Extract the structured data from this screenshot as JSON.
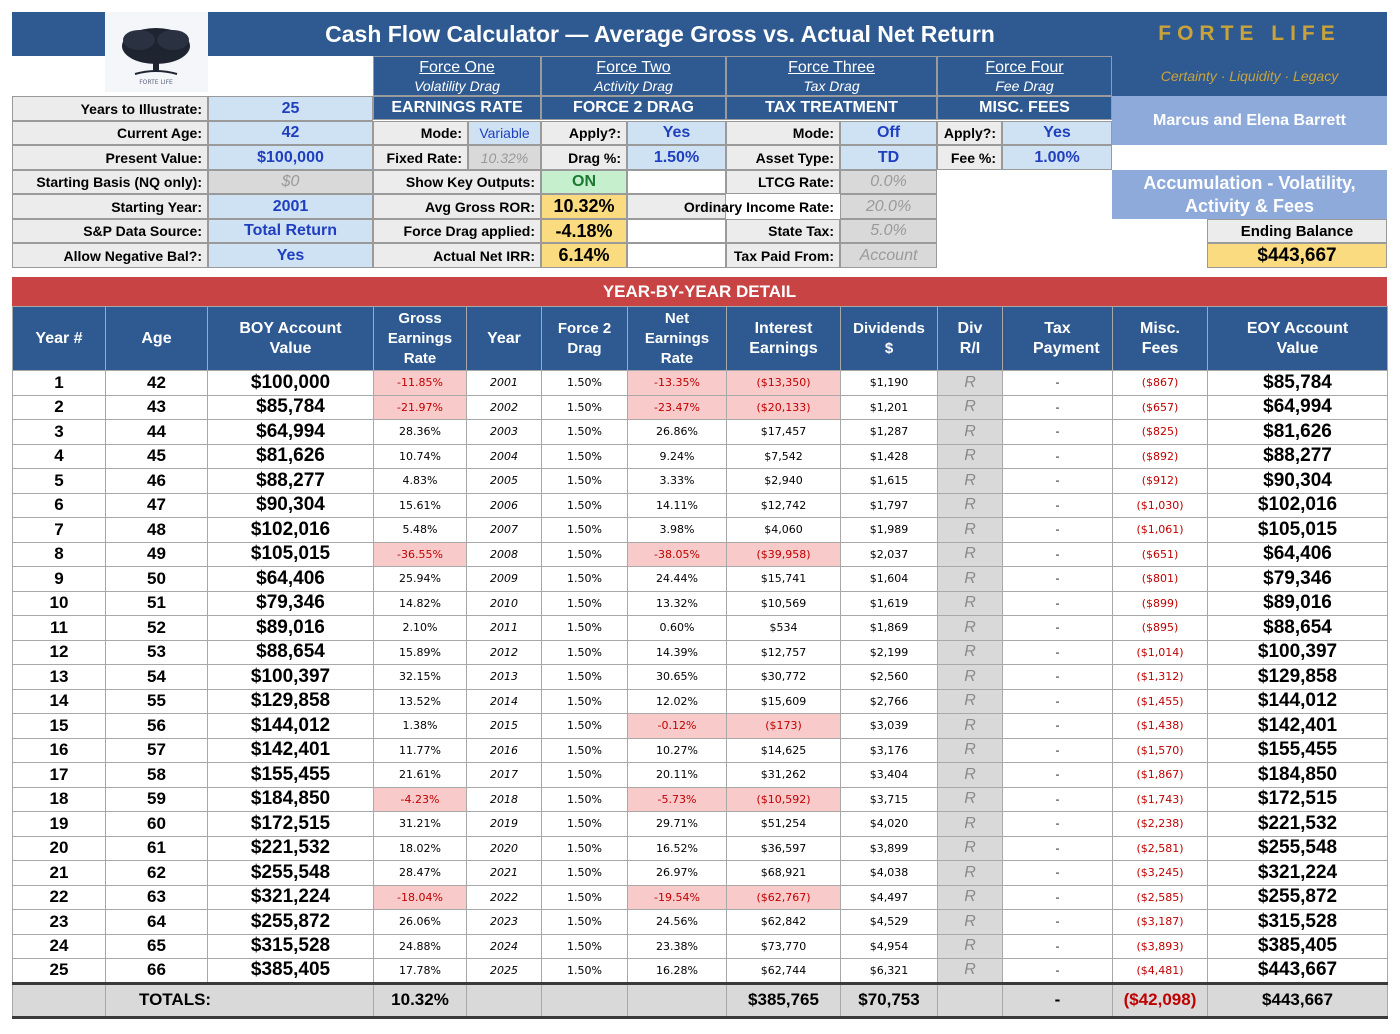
{
  "title": "Cash Flow Calculator — Average Gross vs. Actual Net Return",
  "logo_text": "FORTE LIFE",
  "brand": {
    "name": "FORTE LIFE",
    "tagline": "Certainty · Liquidity · Legacy"
  },
  "forces": [
    {
      "title": "Force One",
      "subtitle": "Volatility Drag",
      "section": "EARNINGS RATE"
    },
    {
      "title": "Force Two",
      "subtitle": "Activity Drag",
      "section": "FORCE 2 DRAG"
    },
    {
      "title": "Force Three",
      "subtitle": "Tax Drag",
      "section": "TAX TREATMENT"
    },
    {
      "title": "Force Four",
      "subtitle": "Fee Drag",
      "section": "MISC. FEES"
    }
  ],
  "inputs": {
    "years_label": "Years to Illustrate:",
    "years": "25",
    "age_label": "Current Age:",
    "age": "42",
    "pv_label": "Present Value:",
    "pv": "$100,000",
    "basis_label": "Starting Basis (NQ only):",
    "basis": "$0",
    "start_year_label": "Starting Year:",
    "start_year": "2001",
    "source_label": "S&P Data Source:",
    "source": "Total Return",
    "neg_label": "Allow Negative Bal?:",
    "neg": "Yes"
  },
  "force1": {
    "mode_label": "Mode:",
    "mode": "Variable",
    "fixed_label": "Fixed Rate:",
    "fixed": "10.32%",
    "show_label": "Show Key Outputs:",
    "show": "ON",
    "avg_label": "Avg Gross ROR:",
    "avg": "10.32%",
    "drag_label": "Force Drag applied:",
    "drag": "-4.18%",
    "irr_label": "Actual Net IRR:",
    "irr": "6.14%"
  },
  "force2": {
    "apply_label": "Apply?:",
    "apply": "Yes",
    "drag_label": "Drag %:",
    "drag": "1.50%"
  },
  "force3": {
    "mode_label": "Mode:",
    "mode": "Off",
    "asset_label": "Asset Type:",
    "asset": "TD",
    "ltcg_label": "LTCG Rate:",
    "ltcg": "0.0%",
    "ord_label": "Ordinary Income Rate:",
    "ord": "20.0%",
    "state_label": "State Tax:",
    "state": "5.0%",
    "paid_label": "Tax Paid From:",
    "paid": "Account"
  },
  "force4": {
    "apply_label": "Apply?:",
    "apply": "Yes",
    "fee_label": "Fee %:",
    "fee": "1.00%"
  },
  "client": "Marcus and Elena Barrett",
  "scenario": "Accumulation - Volatility, Activity & Fees",
  "ending_label": "Ending Balance",
  "ending_value": "$443,667",
  "detail_title": "YEAR-BY-YEAR DETAIL",
  "columns": [
    "Year #",
    "Age",
    "BOY Account Value",
    "Gross Earnings Rate",
    "Year",
    "Force 2 Drag",
    "Net Earnings Rate",
    "Interest Earnings",
    "Dividends $",
    "Div R/I",
    "Tax Payment",
    "Misc. Fees",
    "EOY Account Value"
  ],
  "rows": [
    [
      "1",
      "42",
      "$100,000",
      "-11.85%",
      "2001",
      "1.50%",
      "-13.35%",
      "($13,350)",
      "$1,190",
      "R",
      "-",
      "($867)",
      "$85,784"
    ],
    [
      "2",
      "43",
      "$85,784",
      "-21.97%",
      "2002",
      "1.50%",
      "-23.47%",
      "($20,133)",
      "$1,201",
      "R",
      "-",
      "($657)",
      "$64,994"
    ],
    [
      "3",
      "44",
      "$64,994",
      "28.36%",
      "2003",
      "1.50%",
      "26.86%",
      "$17,457",
      "$1,287",
      "R",
      "-",
      "($825)",
      "$81,626"
    ],
    [
      "4",
      "45",
      "$81,626",
      "10.74%",
      "2004",
      "1.50%",
      "9.24%",
      "$7,542",
      "$1,428",
      "R",
      "-",
      "($892)",
      "$88,277"
    ],
    [
      "5",
      "46",
      "$88,277",
      "4.83%",
      "2005",
      "1.50%",
      "3.33%",
      "$2,940",
      "$1,615",
      "R",
      "-",
      "($912)",
      "$90,304"
    ],
    [
      "6",
      "47",
      "$90,304",
      "15.61%",
      "2006",
      "1.50%",
      "14.11%",
      "$12,742",
      "$1,797",
      "R",
      "-",
      "($1,030)",
      "$102,016"
    ],
    [
      "7",
      "48",
      "$102,016",
      "5.48%",
      "2007",
      "1.50%",
      "3.98%",
      "$4,060",
      "$1,989",
      "R",
      "-",
      "($1,061)",
      "$105,015"
    ],
    [
      "8",
      "49",
      "$105,015",
      "-36.55%",
      "2008",
      "1.50%",
      "-38.05%",
      "($39,958)",
      "$2,037",
      "R",
      "-",
      "($651)",
      "$64,406"
    ],
    [
      "9",
      "50",
      "$64,406",
      "25.94%",
      "2009",
      "1.50%",
      "24.44%",
      "$15,741",
      "$1,604",
      "R",
      "-",
      "($801)",
      "$79,346"
    ],
    [
      "10",
      "51",
      "$79,346",
      "14.82%",
      "2010",
      "1.50%",
      "13.32%",
      "$10,569",
      "$1,619",
      "R",
      "-",
      "($899)",
      "$89,016"
    ],
    [
      "11",
      "52",
      "$89,016",
      "2.10%",
      "2011",
      "1.50%",
      "0.60%",
      "$534",
      "$1,869",
      "R",
      "-",
      "($895)",
      "$88,654"
    ],
    [
      "12",
      "53",
      "$88,654",
      "15.89%",
      "2012",
      "1.50%",
      "14.39%",
      "$12,757",
      "$2,199",
      "R",
      "-",
      "($1,014)",
      "$100,397"
    ],
    [
      "13",
      "54",
      "$100,397",
      "32.15%",
      "2013",
      "1.50%",
      "30.65%",
      "$30,772",
      "$2,560",
      "R",
      "-",
      "($1,312)",
      "$129,858"
    ],
    [
      "14",
      "55",
      "$129,858",
      "13.52%",
      "2014",
      "1.50%",
      "12.02%",
      "$15,609",
      "$2,766",
      "R",
      "-",
      "($1,455)",
      "$144,012"
    ],
    [
      "15",
      "56",
      "$144,012",
      "1.38%",
      "2015",
      "1.50%",
      "-0.12%",
      "($173)",
      "$3,039",
      "R",
      "-",
      "($1,438)",
      "$142,401"
    ],
    [
      "16",
      "57",
      "$142,401",
      "11.77%",
      "2016",
      "1.50%",
      "10.27%",
      "$14,625",
      "$3,176",
      "R",
      "-",
      "($1,570)",
      "$155,455"
    ],
    [
      "17",
      "58",
      "$155,455",
      "21.61%",
      "2017",
      "1.50%",
      "20.11%",
      "$31,262",
      "$3,404",
      "R",
      "-",
      "($1,867)",
      "$184,850"
    ],
    [
      "18",
      "59",
      "$184,850",
      "-4.23%",
      "2018",
      "1.50%",
      "-5.73%",
      "($10,592)",
      "$3,715",
      "R",
      "-",
      "($1,743)",
      "$172,515"
    ],
    [
      "19",
      "60",
      "$172,515",
      "31.21%",
      "2019",
      "1.50%",
      "29.71%",
      "$51,254",
      "$4,020",
      "R",
      "-",
      "($2,238)",
      "$221,532"
    ],
    [
      "20",
      "61",
      "$221,532",
      "18.02%",
      "2020",
      "1.50%",
      "16.52%",
      "$36,597",
      "$3,899",
      "R",
      "-",
      "($2,581)",
      "$255,548"
    ],
    [
      "21",
      "62",
      "$255,548",
      "28.47%",
      "2021",
      "1.50%",
      "26.97%",
      "$68,921",
      "$4,038",
      "R",
      "-",
      "($3,245)",
      "$321,224"
    ],
    [
      "22",
      "63",
      "$321,224",
      "-18.04%",
      "2022",
      "1.50%",
      "-19.54%",
      "($62,767)",
      "$4,497",
      "R",
      "-",
      "($2,585)",
      "$255,872"
    ],
    [
      "23",
      "64",
      "$255,872",
      "26.06%",
      "2023",
      "1.50%",
      "24.56%",
      "$62,842",
      "$4,529",
      "R",
      "-",
      "($3,187)",
      "$315,528"
    ],
    [
      "24",
      "65",
      "$315,528",
      "24.88%",
      "2024",
      "1.50%",
      "23.38%",
      "$73,770",
      "$4,954",
      "R",
      "-",
      "($3,893)",
      "$385,405"
    ],
    [
      "25",
      "66",
      "$385,405",
      "17.78%",
      "2025",
      "1.50%",
      "16.28%",
      "$62,744",
      "$6,321",
      "R",
      "-",
      "($4,481)",
      "$443,667"
    ]
  ],
  "totals": {
    "label": "TOTALS:",
    "gross": "10.32%",
    "interest": "$385,765",
    "dividends": "$70,753",
    "tax": "-",
    "fees": "($42,098)",
    "eoy": "$443,667"
  },
  "colors": {
    "navy": "#2e5a91",
    "red_bar": "#c84343",
    "negative_fill": "#f8caca",
    "negative_text": "#c00000",
    "input_fill": "#cfe2f3",
    "highlight": "#fbdb7f",
    "brand_gold": "#c9a33a"
  }
}
